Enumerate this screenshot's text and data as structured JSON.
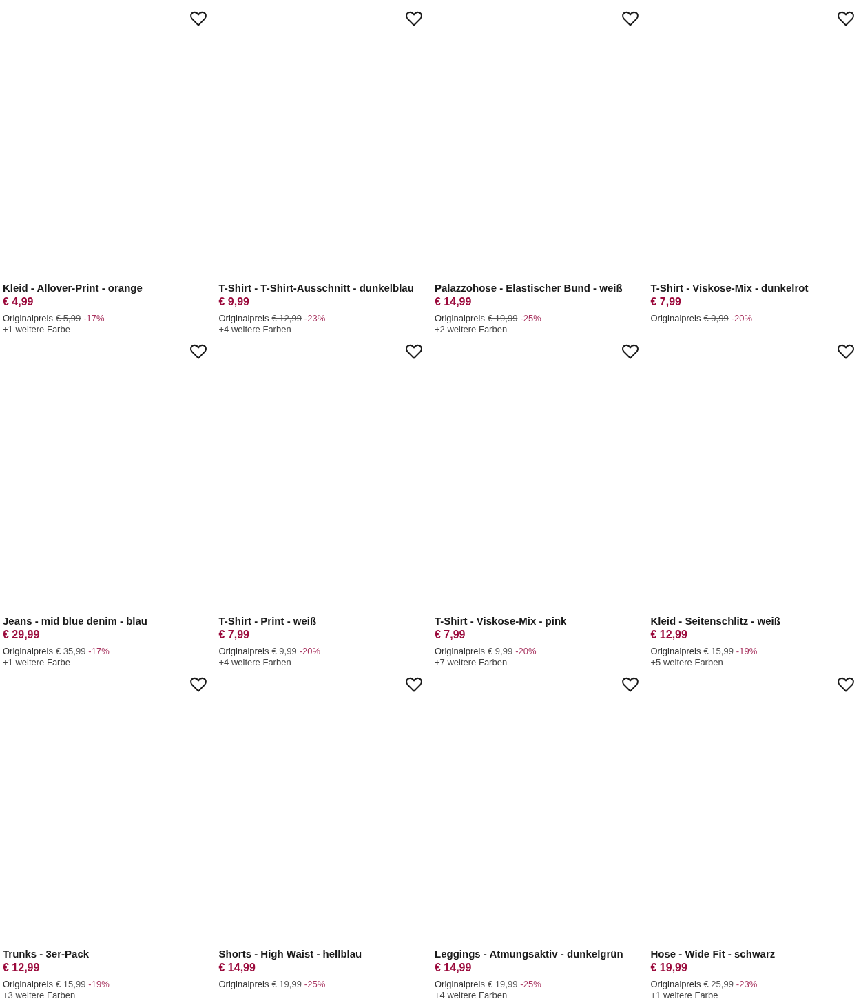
{
  "products": [
    {
      "title": "Kleid - Allover-Print - orange",
      "price": "€ 4,99",
      "original_label": "Originalpreis",
      "old_price": "€ 5,99",
      "discount": "-17%",
      "more_colors": "+1 weitere Farbe"
    },
    {
      "title": "T-Shirt - T-Shirt-Ausschnitt - dunkelblau",
      "price": "€ 9,99",
      "original_label": "Originalpreis",
      "old_price": "€ 12,99",
      "discount": "-23%",
      "more_colors": "+4 weitere Farben"
    },
    {
      "title": "Palazzohose - Elastischer Bund - weiß",
      "price": "€ 14,99",
      "original_label": "Originalpreis",
      "old_price": "€ 19,99",
      "discount": "-25%",
      "more_colors": "+2 weitere Farben"
    },
    {
      "title": "T-Shirt - Viskose-Mix - dunkelrot",
      "price": "€ 7,99",
      "original_label": "Originalpreis",
      "old_price": "€ 9,99",
      "discount": "-20%"
    },
    {
      "title": "Jeans - mid blue denim - blau",
      "price": "€ 29,99",
      "original_label": "Originalpreis",
      "old_price": "€ 35,99",
      "discount": "-17%",
      "more_colors": "+1 weitere Farbe"
    },
    {
      "title": "T-Shirt - Print - weiß",
      "price": "€ 7,99",
      "original_label": "Originalpreis",
      "old_price": "€ 9,99",
      "discount": "-20%",
      "more_colors": "+4 weitere Farben"
    },
    {
      "title": "T-Shirt - Viskose-Mix - pink",
      "price": "€ 7,99",
      "original_label": "Originalpreis",
      "old_price": "€ 9,99",
      "discount": "-20%",
      "more_colors": "+7 weitere Farben"
    },
    {
      "title": "Kleid - Seitenschlitz - weiß",
      "price": "€ 12,99",
      "original_label": "Originalpreis",
      "old_price": "€ 15,99",
      "discount": "-19%",
      "more_colors": "+5 weitere Farben"
    },
    {
      "title": "Trunks - 3er-Pack",
      "price": "€ 12,99",
      "original_label": "Originalpreis",
      "old_price": "€ 15,99",
      "discount": "-19%",
      "more_colors": "+3 weitere Farben"
    },
    {
      "title": "Shorts - High Waist - hellblau",
      "price": "€ 14,99",
      "original_label": "Originalpreis",
      "old_price": "€ 19,99",
      "discount": "-25%"
    },
    {
      "title": "Leggings - Atmungsaktiv - dunkelgrün",
      "price": "€ 14,99",
      "original_label": "Originalpreis",
      "old_price": "€ 19,99",
      "discount": "-25%",
      "more_colors": "+4 weitere Farben"
    },
    {
      "title": "Hose - Wide Fit - schwarz",
      "price": "€ 19,99",
      "original_label": "Originalpreis",
      "old_price": "€ 25,99",
      "discount": "-23%",
      "more_colors": "+1 weitere Farbe"
    }
  ]
}
